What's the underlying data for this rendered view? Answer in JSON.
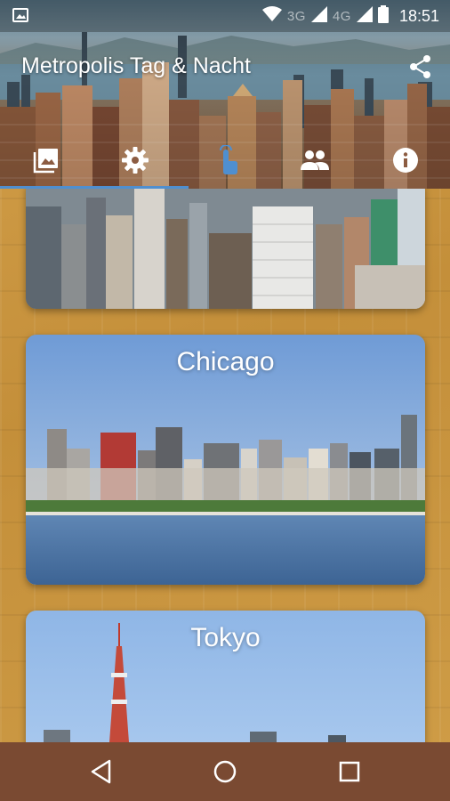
{
  "status_bar": {
    "network_1": "3G",
    "network_2": "4G",
    "time": "18:51"
  },
  "app_bar": {
    "title": "Metropolis Tag & Nacht",
    "icons": [
      "gallery-icon",
      "settings-icon",
      "touch-icon",
      "people-icon",
      "info-icon",
      "share-icon"
    ],
    "accent_color": "#4f8fd0"
  },
  "cities": [
    {
      "name": ""
    },
    {
      "name": "Chicago"
    },
    {
      "name": "Tokyo"
    }
  ],
  "nav_bar": {
    "buttons": [
      "back-icon",
      "home-icon",
      "recents-icon"
    ],
    "color": "#7a4a32"
  }
}
